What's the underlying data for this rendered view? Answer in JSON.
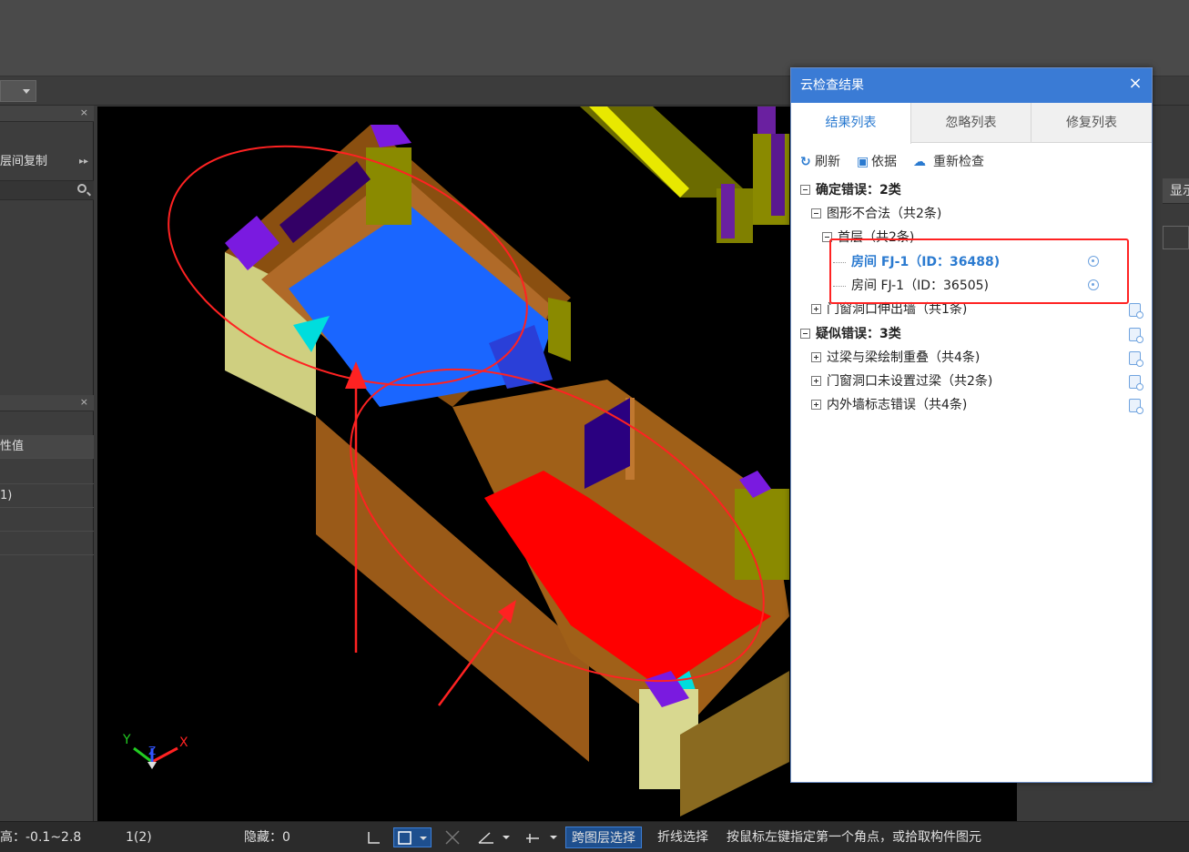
{
  "left_panel": {
    "layer_copy_label": "层间复制",
    "property_value_header": "性值",
    "property_row_value": "1)"
  },
  "dialog": {
    "title": "云检查结果",
    "close_glyph": "×",
    "tabs": [
      "结果列表",
      "忽略列表",
      "修复列表"
    ],
    "actions": {
      "refresh": "刷新",
      "basis": "依据",
      "recheck": "重新检查"
    },
    "tree": {
      "confirmed": "确定错误：2类",
      "shape_invalid": "图形不合法（共2条)",
      "floor": "首层（共2条)",
      "item1": "房间 FJ-1（ID：36488)",
      "item2": "房间 FJ-1（ID：36505)",
      "door_window_out": "门窗洞口伸出墙（共1条)",
      "suspected": "疑似错误：3类",
      "beam_overlap": "过梁与梁绘制重叠（共4条)",
      "no_lintel": "门窗洞口未设置过梁（共2条)",
      "wall_flag": "内外墙标志错误（共4条)"
    }
  },
  "right_strip": {
    "header_text": "显示"
  },
  "statusbar": {
    "elevation": "高：-0.1~2.8",
    "layer": "1(2)",
    "hidden": "隐藏：0",
    "cross_layer_select": "跨图层选择",
    "polyline_select": "折线选择",
    "hint": "按鼠标左键指定第一个角点，或拾取构件图元"
  },
  "axes": {
    "x": "X",
    "y": "Y",
    "z": "Z"
  },
  "colors": {
    "accent": "#3a7bd5",
    "selected_text": "#2a7ad0",
    "annotation": "#ff2222",
    "room_blue": "#1a66ff",
    "room_red": "#ff0000"
  }
}
